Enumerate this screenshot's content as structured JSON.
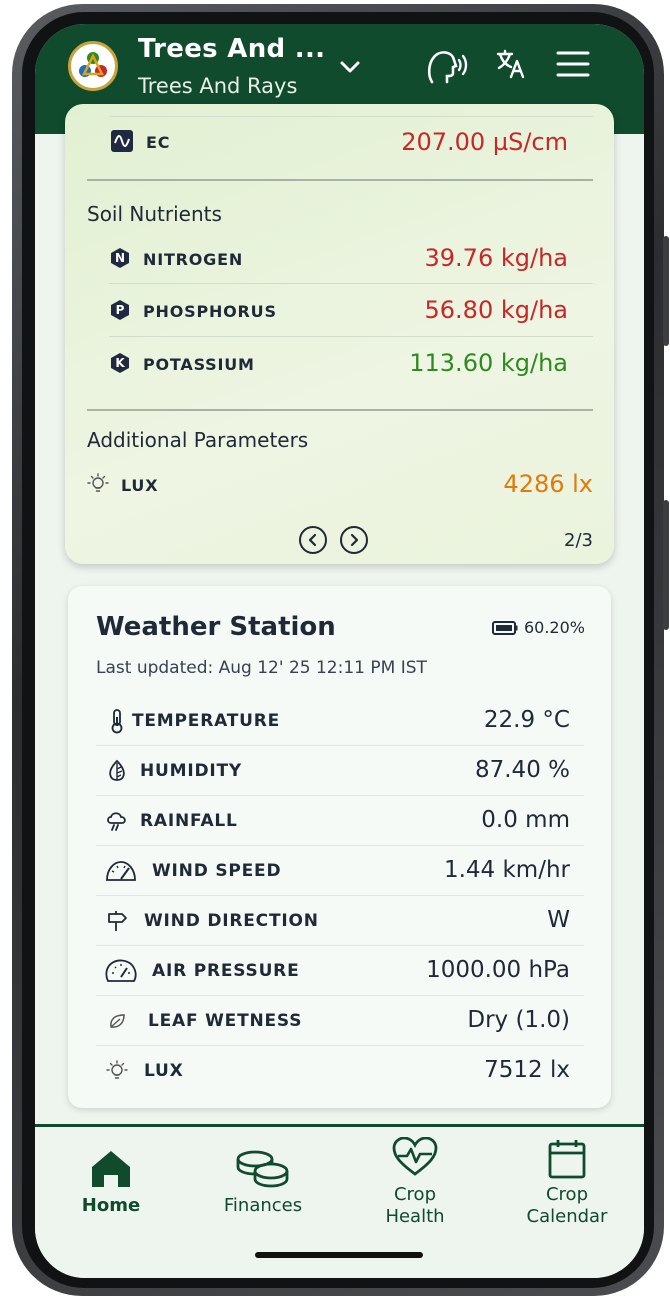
{
  "header": {
    "title": "Trees And ...",
    "subtitle": "Trees And Rays"
  },
  "soil_card": {
    "ec": {
      "label": "EC",
      "value": "207.00 µS/cm",
      "color": "#c62828"
    },
    "nutrients_title": "Soil Nutrients",
    "nutrients": [
      {
        "badge": "N",
        "label": "NITROGEN",
        "value": "39.76 kg/ha",
        "color": "#c62828"
      },
      {
        "badge": "P",
        "label": "PHOSPHORUS",
        "value": "56.80 kg/ha",
        "color": "#c62828"
      },
      {
        "badge": "K",
        "label": "POTASSIUM",
        "value": "113.60 kg/ha",
        "color": "#2e8b1f"
      }
    ],
    "additional_title": "Additional Parameters",
    "lux": {
      "label": "LUX",
      "value": "4286 lx",
      "color": "#e07b0a"
    },
    "pager": "2/3"
  },
  "weather": {
    "title": "Weather Station",
    "battery": "60.20%",
    "updated": "Last updated: Aug 12' 25 12:11 PM IST",
    "rows": [
      {
        "icon": "thermometer-icon",
        "label": "TEMPERATURE",
        "value": "22.9 °C"
      },
      {
        "icon": "humidity-leaf-icon",
        "label": "HUMIDITY",
        "value": "87.40 %"
      },
      {
        "icon": "rain-cloud-icon",
        "label": "RAINFALL",
        "value": "0.0 mm"
      },
      {
        "icon": "speedometer-icon",
        "label": "WIND SPEED",
        "value": "1.44 km/hr"
      },
      {
        "icon": "signpost-icon",
        "label": "WIND DIRECTION",
        "value": "W"
      },
      {
        "icon": "gauge-icon",
        "label": "AIR PRESSURE",
        "value": "1000.00  hPa"
      },
      {
        "icon": "leaf-icon",
        "label": "LEAF WETNESS",
        "value": "Dry (1.0)"
      },
      {
        "icon": "bulb-icon",
        "label": "LUX",
        "value": "7512 lx"
      }
    ]
  },
  "nav": {
    "home": "Home",
    "finances": "Finances",
    "crop_health_1": "Crop",
    "crop_health_2": "Health",
    "crop_calendar_1": "Crop",
    "crop_calendar_2": "Calendar",
    "active": "Home"
  },
  "colors": {
    "brand": "#104b2d",
    "red": "#c62828",
    "green": "#2e8b1f",
    "orange": "#e07b0a"
  }
}
